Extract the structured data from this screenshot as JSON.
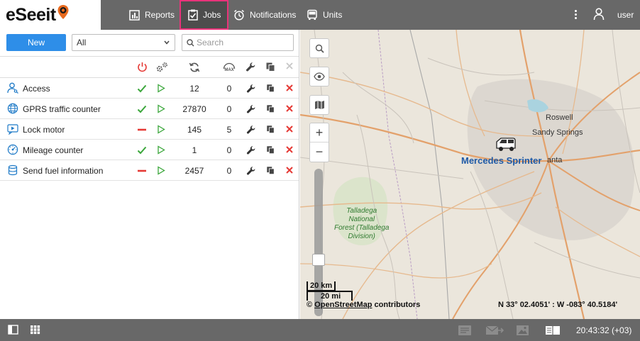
{
  "app": {
    "brand": "eSeeit"
  },
  "nav": {
    "reports": "Reports",
    "jobs": "Jobs",
    "notifications": "Notifications",
    "units": "Units",
    "user": "user"
  },
  "toolbar": {
    "new_label": "New",
    "filter_selected": "All",
    "search_placeholder": "Search"
  },
  "jobs": [
    {
      "name": "Access",
      "icon": "user-key-icon",
      "state": "enabled",
      "count": "12",
      "max": "0"
    },
    {
      "name": "GPRS traffic counter",
      "icon": "globe-icon",
      "state": "enabled",
      "count": "27870",
      "max": "0"
    },
    {
      "name": "Lock motor",
      "icon": "video-icon",
      "state": "disabled",
      "count": "145",
      "max": "5"
    },
    {
      "name": "Mileage counter",
      "icon": "odometer-icon",
      "state": "enabled",
      "count": "1",
      "max": "0"
    },
    {
      "name": "Send fuel information",
      "icon": "database-icon",
      "state": "disabled",
      "count": "2457",
      "max": "0"
    }
  ],
  "map": {
    "unit_label": "Mercedes Sprinter",
    "places": [
      "Roswell",
      "Sandy Springs",
      "anta"
    ],
    "park": [
      "Talladega",
      "National",
      "Forest (Talladega",
      "Division)"
    ],
    "scale_km": "20 km",
    "scale_mi": "20 mi",
    "attribution_prefix": "©",
    "attribution_link": "OpenStreetMap",
    "attribution_suffix": "contributors",
    "coordinates": "N 33° 02.4051' : W -083° 40.5184'"
  },
  "status": {
    "clock": "20:43:32 (+03)"
  },
  "colors": {
    "accent": "#2e8ee8",
    "enabled": "#3aa63a",
    "disabled": "#e53935",
    "topbar": "#686868",
    "active_tab_border": "#e8337a"
  }
}
